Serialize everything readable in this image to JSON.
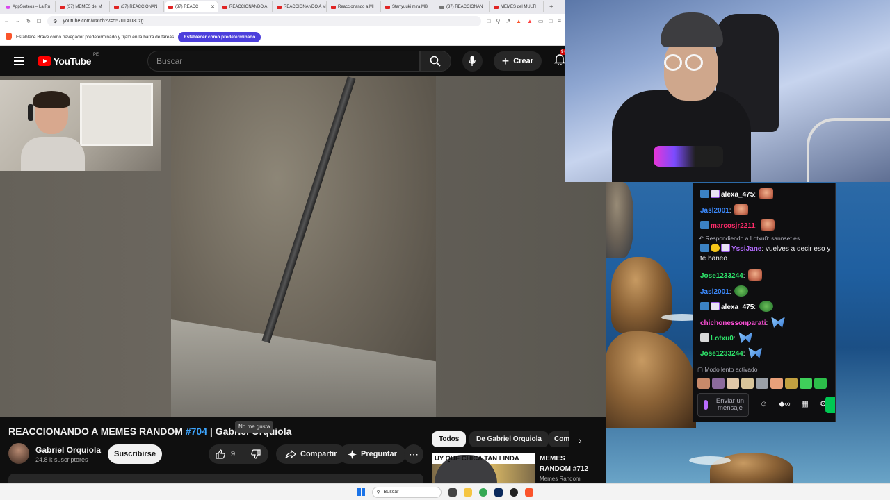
{
  "browser": {
    "tabs": [
      {
        "label": "AppSorteos – La Ru",
        "type": "pink"
      },
      {
        "label": "(37) MEMES del M",
        "type": "yt"
      },
      {
        "label": "(37) REACCIONAN",
        "type": "yt"
      },
      {
        "label": "(37) REACC",
        "type": "yt",
        "active": true
      },
      {
        "label": "REACCIONANDO A",
        "type": "yt"
      },
      {
        "label": "REACCIONANDO A M",
        "type": "yt"
      },
      {
        "label": "Reaccionando a MI",
        "type": "yt"
      },
      {
        "label": "Starryuuki mira MB",
        "type": "yt"
      },
      {
        "label": "(37) REACCIONAN",
        "type": "gray"
      },
      {
        "label": "MEMES del MULTI",
        "type": "yt"
      }
    ],
    "url": "youtube.com/watch?v=q57uTAD80zg",
    "notice_text": "Establece Brave como navegador predeterminado y fíjalo en la barra de tareas",
    "notice_button": "Establecer como predeterminado"
  },
  "youtube": {
    "logo_text": "YouTube",
    "region": "PE",
    "search_placeholder": "Buscar",
    "create_label": "Crear",
    "notif_count": "9+",
    "video": {
      "title_prefix": "REACCIONANDO A MEMES RANDOM ",
      "title_tag": "#704",
      "title_suffix": " | Gabriel Orquiola",
      "channel": "Gabriel Orquiola",
      "subscribers": "24.8 k suscriptores",
      "subscribe_label": "Suscribirse",
      "likes": "9",
      "tooltip": "No me gusta",
      "share_label": "Compartir",
      "ask_label": "Preguntar"
    },
    "chips": [
      "Todos",
      "De Gabriel Orquiola",
      "Com"
    ],
    "related": {
      "thumb_caption": "UY QUE CHICA TAN LINDA",
      "title": "MEMES RANDOM #712",
      "channel": "Memes Random"
    }
  },
  "chat": {
    "messages": [
      {
        "user": "alexa_475",
        "color": "#ffffff",
        "badges": [
          "prime",
          "sub"
        ],
        "text": "",
        "emote": "face"
      },
      {
        "user": "Jasl2001",
        "color": "#3d8bff",
        "badges": [],
        "text": "",
        "emote": "face"
      },
      {
        "user": "marcosjr2211",
        "color": "#ff2b6a",
        "badges": [
          "prime"
        ],
        "text": "",
        "emote": "face"
      },
      {
        "user": "YssiJane",
        "color": "#b46cff",
        "badges": [
          "prime",
          "gold",
          "sub"
        ],
        "text": "vuelves a decir eso y te baneo",
        "emote": ""
      },
      {
        "user": "Jose1233244",
        "color": "#2ee66b",
        "badges": [],
        "text": "",
        "emote": "face"
      },
      {
        "user": "Jasl2001",
        "color": "#3d8bff",
        "badges": [],
        "text": "",
        "emote": "frog"
      },
      {
        "user": "alexa_475",
        "color": "#ffffff",
        "badges": [
          "prime",
          "sub"
        ],
        "text": "",
        "emote": "frog"
      },
      {
        "user": "chichonessonparati",
        "color": "#ff4fd8",
        "badges": [],
        "text": "",
        "emote": "bfly"
      },
      {
        "user": "Lotxu0",
        "color": "#2ee66b",
        "badges": [
          "gift"
        ],
        "text": "",
        "emote": "bfly"
      },
      {
        "user": "Jose1233244",
        "color": "#2ee66b",
        "badges": [],
        "text": "",
        "emote": "bfly"
      }
    ],
    "reply_context": "Respondiendo a Lotxu0: sannset es ...",
    "slow_mode": "Modo lento activado",
    "input_placeholder": "Enviar un mensaje"
  },
  "taskbar": {
    "search_label": "Buscar"
  }
}
